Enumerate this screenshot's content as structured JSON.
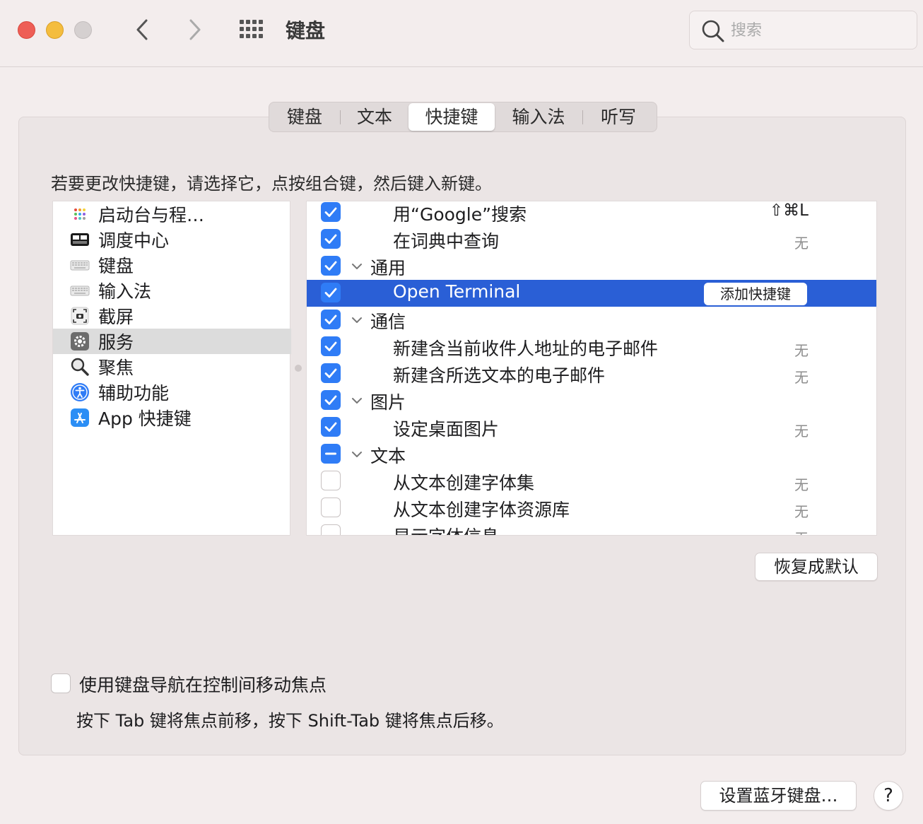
{
  "window": {
    "title": "键盘",
    "search_placeholder": "搜索"
  },
  "tabs": [
    {
      "label": "键盘",
      "active": false
    },
    {
      "label": "文本",
      "active": false
    },
    {
      "label": "快捷键",
      "active": true
    },
    {
      "label": "输入法",
      "active": false
    },
    {
      "label": "听写",
      "active": false
    }
  ],
  "instruction": "若要更改快捷键，请选择它，点按组合键，然后键入新键。",
  "categories": [
    {
      "label": "启动台与程…",
      "icon": "launchpad-icon",
      "selected": false
    },
    {
      "label": "调度中心",
      "icon": "mission-control-icon",
      "selected": false
    },
    {
      "label": "键盘",
      "icon": "keyboard-icon",
      "selected": false
    },
    {
      "label": "输入法",
      "icon": "input-source-icon",
      "selected": false
    },
    {
      "label": "截屏",
      "icon": "screenshot-icon",
      "selected": false
    },
    {
      "label": "服务",
      "icon": "gear-icon",
      "selected": true
    },
    {
      "label": "聚焦",
      "icon": "spotlight-icon",
      "selected": false
    },
    {
      "label": "辅助功能",
      "icon": "accessibility-icon",
      "selected": false
    },
    {
      "label": "App 快捷键",
      "icon": "app-store-icon",
      "selected": false
    }
  ],
  "shortcuts": [
    {
      "label": "用“Google”搜索",
      "type": "item",
      "checkbox": "on",
      "shortcut": "⇧⌘L",
      "selected": false
    },
    {
      "label": "在词典中查询",
      "type": "item",
      "checkbox": "on",
      "shortcut": "无",
      "selected": false
    },
    {
      "label": "通用",
      "type": "group",
      "checkbox": "on",
      "shortcut": "",
      "selected": false
    },
    {
      "label": "Open Terminal",
      "type": "item",
      "checkbox": "on",
      "shortcut": "",
      "selected": true,
      "button": "添加快捷键"
    },
    {
      "label": "通信",
      "type": "group",
      "checkbox": "on",
      "shortcut": "",
      "selected": false
    },
    {
      "label": "新建含当前收件人地址的电子邮件",
      "type": "item",
      "checkbox": "on",
      "shortcut": "无",
      "selected": false
    },
    {
      "label": "新建含所选文本的电子邮件",
      "type": "item",
      "checkbox": "on",
      "shortcut": "无",
      "selected": false
    },
    {
      "label": "图片",
      "type": "group",
      "checkbox": "on",
      "shortcut": "",
      "selected": false
    },
    {
      "label": "设定桌面图片",
      "type": "item",
      "checkbox": "on",
      "shortcut": "无",
      "selected": false
    },
    {
      "label": "文本",
      "type": "group",
      "checkbox": "mixed",
      "shortcut": "",
      "selected": false
    },
    {
      "label": "从文本创建字体集",
      "type": "item",
      "checkbox": "off",
      "shortcut": "无",
      "selected": false
    },
    {
      "label": "从文本创建字体资源库",
      "type": "item",
      "checkbox": "off",
      "shortcut": "无",
      "selected": false
    },
    {
      "label": "显示字体信息",
      "type": "item",
      "checkbox": "off",
      "shortcut": "无",
      "selected": false
    }
  ],
  "restore_button": "恢复成默认",
  "keyboard_navigation": {
    "label": "使用键盘导航在控制间移动焦点",
    "checked": false,
    "hint": "按下 Tab 键将焦点前移，按下 Shift-Tab 键将焦点后移。"
  },
  "bluetooth_button": "设置蓝牙键盘…",
  "help_button": "?",
  "colors": {
    "accent": "#2f7cf6",
    "selection": "#2a5fd6",
    "close": "#ee5e56",
    "minimize": "#f4bd3e"
  }
}
